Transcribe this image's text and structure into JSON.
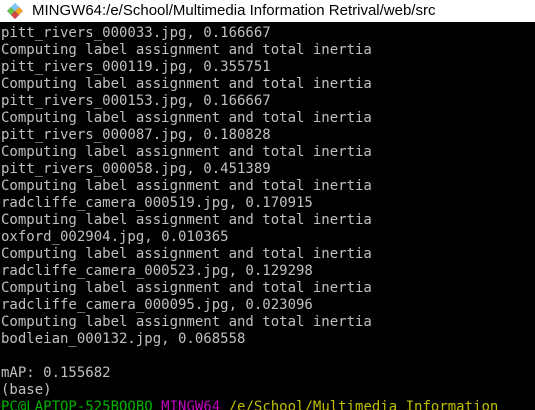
{
  "window": {
    "title": "MINGW64:/e/School/Multimedia Information Retrival/web/src",
    "icon": "mingw-app-icon"
  },
  "terminal": {
    "lines": [
      "pitt_rivers_000033.jpg, 0.166667",
      "Computing label assignment and total inertia",
      "pitt_rivers_000119.jpg, 0.355751",
      "Computing label assignment and total inertia",
      "pitt_rivers_000153.jpg, 0.166667",
      "Computing label assignment and total inertia",
      "pitt_rivers_000087.jpg, 0.180828",
      "Computing label assignment and total inertia",
      "pitt_rivers_000058.jpg, 0.451389",
      "Computing label assignment and total inertia",
      "radcliffe_camera_000519.jpg, 0.170915",
      "Computing label assignment and total inertia",
      "oxford_002904.jpg, 0.010365",
      "Computing label assignment and total inertia",
      "radcliffe_camera_000523.jpg, 0.129298",
      "Computing label assignment and total inertia",
      "radcliffe_camera_000095.jpg, 0.023096",
      "Computing label assignment and total inertia",
      "bodleian_000132.jpg, 0.068558"
    ],
    "map_line": "mAP: 0.155682",
    "env_line": "(base)",
    "prompt": {
      "user_host": "PC@LAPTOP-525BQOBQ",
      "system": "MINGW64",
      "path": "/e/School/Multimedia Information"
    },
    "colors": {
      "background": "#000000",
      "text": "#c0c0c0",
      "prompt_user": "#00b400",
      "prompt_system": "#bf00bf",
      "prompt_path": "#bfbf00"
    }
  }
}
